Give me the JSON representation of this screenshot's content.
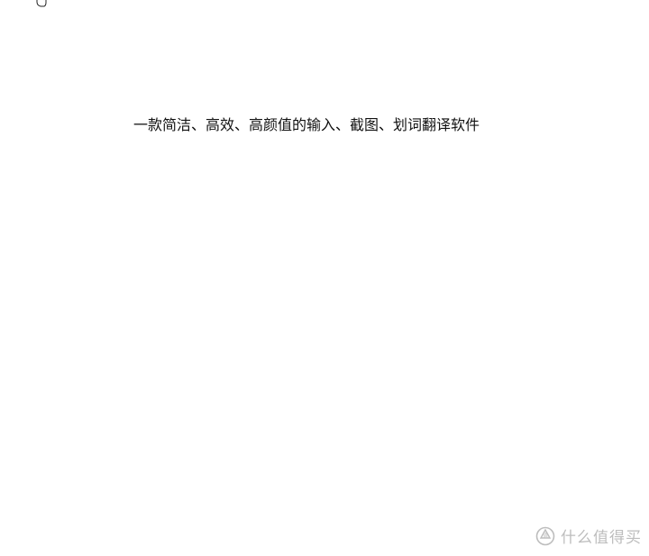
{
  "main": {
    "tagline": "一款简洁、高效、高颜值的输入、截图、划词翻译软件"
  },
  "watermark": {
    "text": "什么值得买"
  },
  "icons": {
    "cursor": "hand-cursor-icon",
    "watermark_logo": "smzdm-logo-icon"
  },
  "colors": {
    "background": "#ffffff",
    "text": "#111111",
    "watermark": "#bdbdbd"
  }
}
